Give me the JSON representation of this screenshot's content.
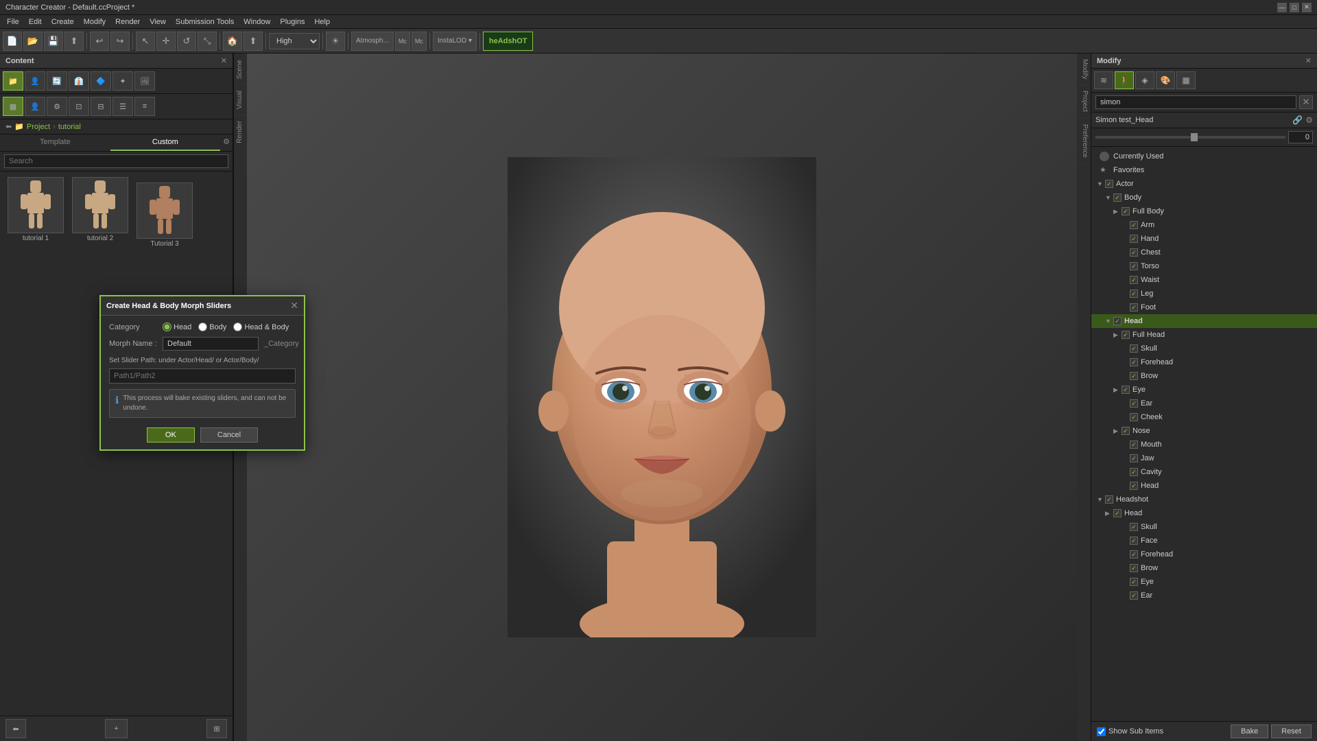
{
  "app": {
    "title": "Character Creator - Default.ccProject *",
    "close": "✕",
    "minimize": "—",
    "maximize": "□"
  },
  "menu": {
    "items": [
      "File",
      "Edit",
      "Create",
      "Modify",
      "Render",
      "View",
      "Submission Tools",
      "Window",
      "Plugins",
      "Help"
    ]
  },
  "toolbar": {
    "quality": "High",
    "headshot_label": "heAdshOT"
  },
  "left_panel": {
    "title": "Content",
    "tabs": [
      "Template",
      "Custom"
    ],
    "active_tab": "Custom",
    "breadcrumb": [
      "Project",
      "tutorial"
    ],
    "search_placeholder": "Search",
    "thumbnails": [
      {
        "label": "tutorial 1"
      },
      {
        "label": "tutorial 2"
      },
      {
        "label": "Tutorial 3"
      }
    ]
  },
  "side_tabs": [
    "Scene",
    "Visual",
    "Render"
  ],
  "right_side_tabs": [
    "Modify",
    "Project",
    "Preference"
  ],
  "right_panel": {
    "title": "Modify",
    "search_value": "simon",
    "property_name": "Simon test_Head",
    "property_value": "0",
    "tree": {
      "items": [
        {
          "id": "currently-used",
          "label": "Currently Used",
          "level": 0,
          "checked": false,
          "hasArrow": false,
          "isSelected": false
        },
        {
          "id": "favorites",
          "label": "Favorites",
          "level": 0,
          "checked": false,
          "hasArrow": false,
          "isSelected": false
        },
        {
          "id": "actor",
          "label": "Actor",
          "level": 0,
          "checked": true,
          "hasArrow": true,
          "expanded": true,
          "isSelected": false
        },
        {
          "id": "body",
          "label": "Body",
          "level": 1,
          "checked": true,
          "hasArrow": true,
          "expanded": true,
          "isSelected": false
        },
        {
          "id": "full-body",
          "label": "Full Body",
          "level": 2,
          "checked": true,
          "hasArrow": true,
          "expanded": false,
          "isSelected": false
        },
        {
          "id": "arm",
          "label": "Arm",
          "level": 3,
          "checked": true,
          "hasArrow": false,
          "isSelected": false
        },
        {
          "id": "hand",
          "label": "Hand",
          "level": 3,
          "checked": true,
          "hasArrow": false,
          "isSelected": false
        },
        {
          "id": "chest",
          "label": "Chest",
          "level": 3,
          "checked": true,
          "hasArrow": false,
          "isSelected": false
        },
        {
          "id": "torso",
          "label": "Torso",
          "level": 3,
          "checked": true,
          "hasArrow": false,
          "isSelected": false
        },
        {
          "id": "waist",
          "label": "Waist",
          "level": 3,
          "checked": true,
          "hasArrow": false,
          "isSelected": false
        },
        {
          "id": "leg",
          "label": "Leg",
          "level": 3,
          "checked": true,
          "hasArrow": false,
          "isSelected": false
        },
        {
          "id": "foot",
          "label": "Foot",
          "level": 3,
          "checked": true,
          "hasArrow": false,
          "isSelected": false
        },
        {
          "id": "head",
          "label": "Head",
          "level": 1,
          "checked": true,
          "hasArrow": true,
          "expanded": true,
          "isSelected": true
        },
        {
          "id": "full-head",
          "label": "Full Head",
          "level": 2,
          "checked": true,
          "hasArrow": true,
          "expanded": false,
          "isSelected": false
        },
        {
          "id": "skull",
          "label": "Skull",
          "level": 3,
          "checked": true,
          "hasArrow": false,
          "isSelected": false
        },
        {
          "id": "forehead",
          "label": "Forehead",
          "level": 3,
          "checked": true,
          "hasArrow": false,
          "isSelected": false
        },
        {
          "id": "brow",
          "label": "Brow",
          "level": 3,
          "checked": true,
          "hasArrow": false,
          "isSelected": false
        },
        {
          "id": "eye",
          "label": "Eye",
          "level": 3,
          "checked": true,
          "hasArrow": true,
          "expanded": false,
          "isSelected": false
        },
        {
          "id": "ear",
          "label": "Ear",
          "level": 3,
          "checked": true,
          "hasArrow": false,
          "isSelected": false
        },
        {
          "id": "cheek",
          "label": "Cheek",
          "level": 3,
          "checked": true,
          "hasArrow": false,
          "isSelected": false
        },
        {
          "id": "nose",
          "label": "Nose",
          "level": 3,
          "checked": true,
          "hasArrow": true,
          "expanded": false,
          "isSelected": false
        },
        {
          "id": "mouth",
          "label": "Mouth",
          "level": 3,
          "checked": true,
          "hasArrow": false,
          "isSelected": false
        },
        {
          "id": "jaw",
          "label": "Jaw",
          "level": 3,
          "checked": true,
          "hasArrow": false,
          "isSelected": false
        },
        {
          "id": "cavity",
          "label": "Cavity",
          "level": 3,
          "checked": true,
          "hasArrow": false,
          "isSelected": false
        },
        {
          "id": "head2",
          "label": "Head",
          "level": 3,
          "checked": true,
          "hasArrow": false,
          "isSelected": false
        },
        {
          "id": "headshot",
          "label": "Headshot",
          "level": 1,
          "checked": true,
          "hasArrow": true,
          "expanded": true,
          "isSelected": false
        },
        {
          "id": "headshot-head",
          "label": "Head",
          "level": 2,
          "checked": true,
          "hasArrow": true,
          "expanded": false,
          "isSelected": false
        },
        {
          "id": "headshot-skull",
          "label": "Skull",
          "level": 3,
          "checked": true,
          "hasArrow": false,
          "isSelected": false
        },
        {
          "id": "headshot-face",
          "label": "Face",
          "level": 3,
          "checked": true,
          "hasArrow": false,
          "isSelected": false
        },
        {
          "id": "headshot-forehead",
          "label": "Forehead",
          "level": 3,
          "checked": true,
          "hasArrow": false,
          "isSelected": false
        },
        {
          "id": "headshot-brow",
          "label": "Brow",
          "level": 3,
          "checked": true,
          "hasArrow": false,
          "isSelected": false
        },
        {
          "id": "headshot-eye",
          "label": "Eye",
          "level": 3,
          "checked": true,
          "hasArrow": false,
          "isSelected": false
        },
        {
          "id": "headshot-ear",
          "label": "Ear",
          "level": 3,
          "checked": true,
          "hasArrow": false,
          "isSelected": false
        }
      ]
    },
    "show_sub_items_label": "Show Sub Items",
    "bake_label": "Bake",
    "reset_label": "Reset"
  },
  "dialog": {
    "title": "Create Head & Body Morph Sliders",
    "category_label": "Category",
    "category_options": [
      "Head",
      "Body",
      "Head & Body"
    ],
    "active_category": "Head",
    "morph_name_label": "Morph Name :",
    "morph_name_value": "Default",
    "morph_name_suffix": "_Category",
    "path_label": "Set Slider Path: under Actor/Head/ or Actor/Body/",
    "path_placeholder": "Path1/Path2",
    "info_text": "This process will bake existing sliders, and can not be undone.",
    "ok_label": "OK",
    "cancel_label": "Cancel"
  },
  "colors": {
    "accent": "#8BC34A",
    "panel_bg": "#2a2a2a",
    "toolbar_bg": "#333",
    "dialog_border": "#8BC34A"
  }
}
